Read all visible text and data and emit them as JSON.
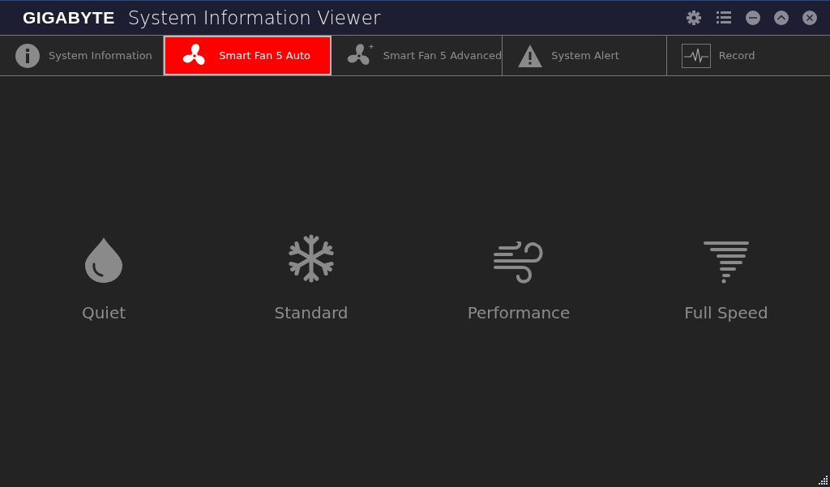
{
  "window": {
    "brand": "GIGABYTE",
    "title": "System Information Viewer"
  },
  "tabs": [
    {
      "label": "System Information",
      "selected": false
    },
    {
      "label": "Smart Fan 5 Auto",
      "selected": true
    },
    {
      "label": "Smart Fan 5 Advanced",
      "selected": false
    },
    {
      "label": "System Alert",
      "selected": false
    },
    {
      "label": "Record",
      "selected": false
    }
  ],
  "modes": [
    {
      "label": "Quiet"
    },
    {
      "label": "Standard"
    },
    {
      "label": "Performance"
    },
    {
      "label": "Full Speed"
    }
  ]
}
